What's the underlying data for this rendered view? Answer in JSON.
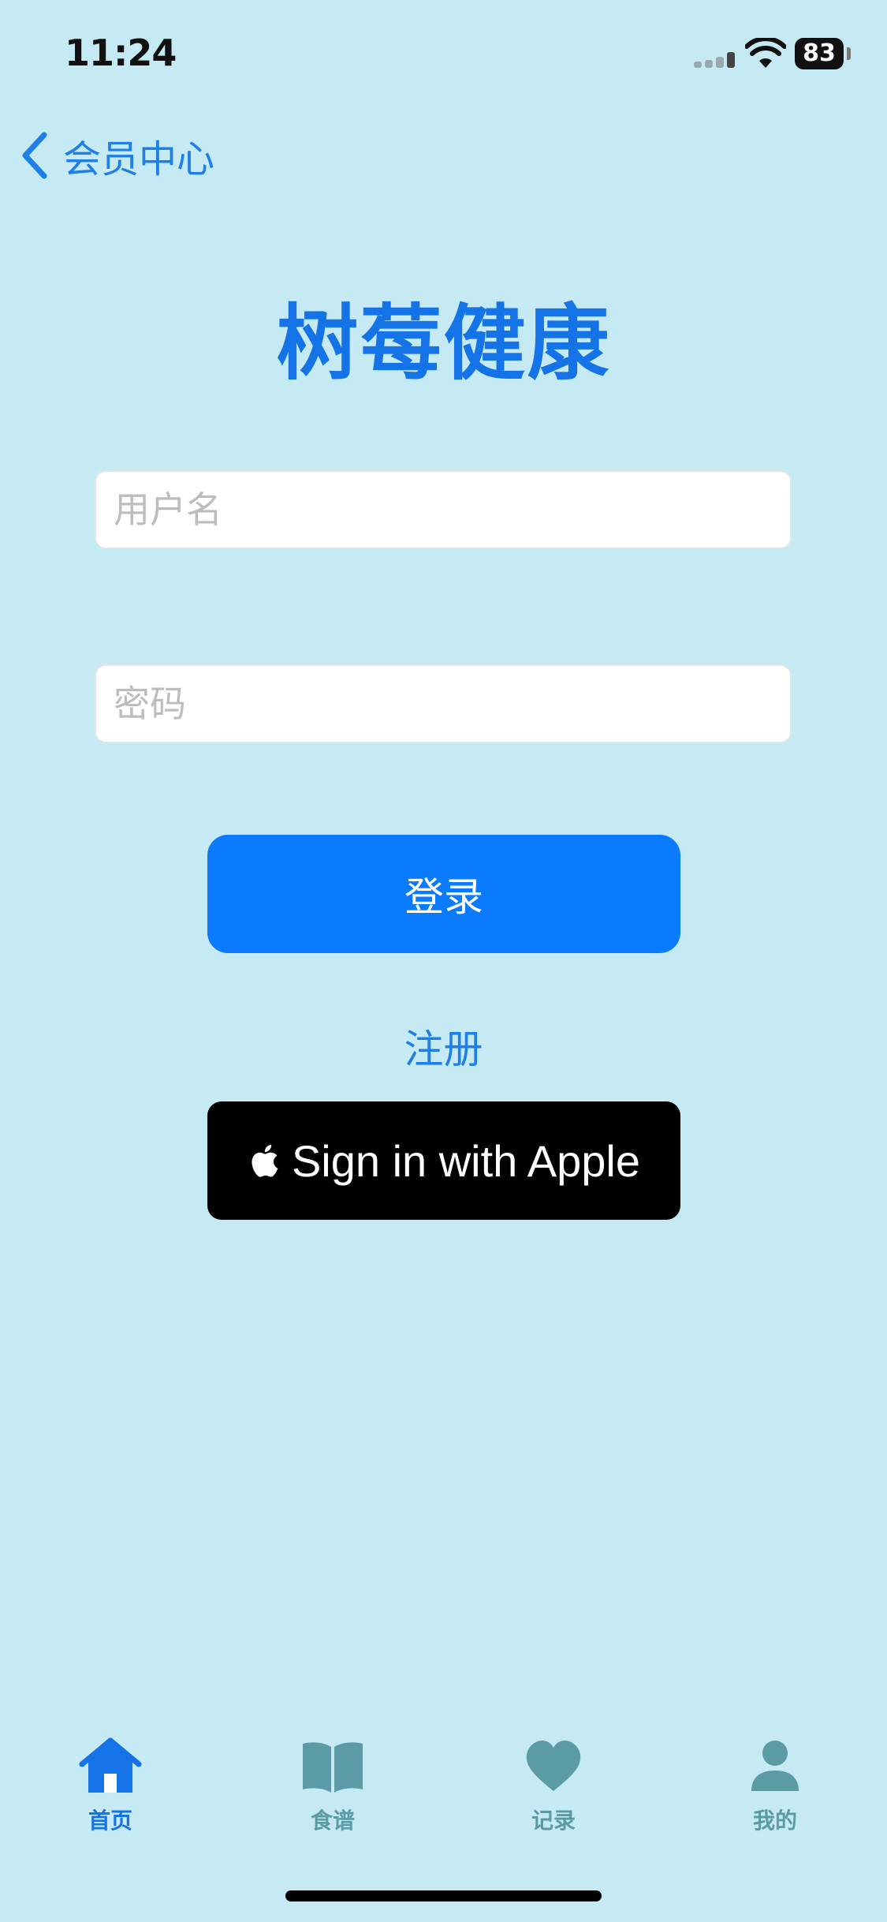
{
  "status_bar": {
    "time": "11:24",
    "battery": "83"
  },
  "nav": {
    "back_label": "会员中心"
  },
  "title": "树莓健康",
  "form": {
    "username_placeholder": "用户名",
    "password_placeholder": "密码",
    "login_label": "登录",
    "register_label": "注册",
    "apple_label": "Sign in with Apple"
  },
  "tabs": [
    {
      "label": "首页",
      "icon": "house-icon",
      "active": true
    },
    {
      "label": "食谱",
      "icon": "book-icon",
      "active": false
    },
    {
      "label": "记录",
      "icon": "heart-icon",
      "active": false
    },
    {
      "label": "我的",
      "icon": "person-icon",
      "active": false
    }
  ],
  "colors": {
    "accent": "#0a7bff",
    "tab_inactive": "#5b9ba6",
    "background": "#c6eaf3"
  }
}
